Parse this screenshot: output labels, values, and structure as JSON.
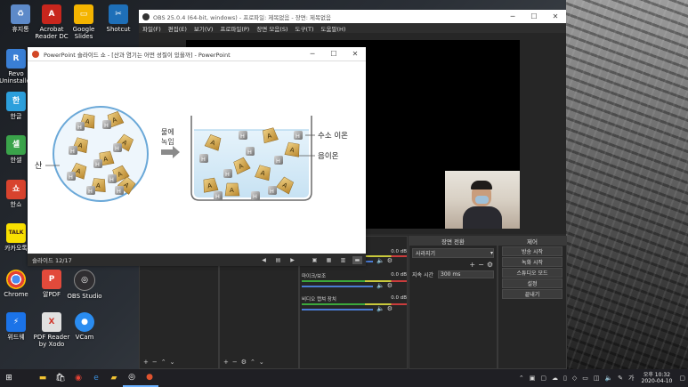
{
  "desktop": {
    "icons": [
      {
        "label": "휴지통",
        "icon": "recycle-bin-icon",
        "color": "#5d8ac9",
        "glyph": "♻"
      },
      {
        "label": "Acrobat Reader DC",
        "icon": "acrobat-icon",
        "color": "#c8261d",
        "glyph": "A"
      },
      {
        "label": "Google Slides",
        "icon": "google-slides-icon",
        "color": "#f4b400",
        "glyph": "▭"
      },
      {
        "label": "Shotcut",
        "icon": "shotcut-icon",
        "color": "#1e6fb8",
        "glyph": "✂"
      },
      {
        "label": "Revo Uninstaller",
        "icon": "revo-icon",
        "color": "#3a7fd5",
        "glyph": "R"
      },
      {
        "label": "한글",
        "icon": "hangul-icon",
        "color": "#2c9fdc",
        "glyph": "한"
      },
      {
        "label": "한셀",
        "icon": "hancell-icon",
        "color": "#3aa34a",
        "glyph": "셀"
      },
      {
        "label": "한쇼",
        "icon": "hanshow-icon",
        "color": "#d8432e",
        "glyph": "쇼"
      },
      {
        "label": "카카오톡",
        "icon": "kakaotalk-icon",
        "color": "#f9e000",
        "glyph": "TALK"
      },
      {
        "label": "Chrome",
        "icon": "chrome-icon",
        "color": "#3a8fdc",
        "glyph": "◉"
      },
      {
        "label": "알PDF",
        "icon": "alpdf-icon",
        "color": "#e24a3b",
        "glyph": "P"
      },
      {
        "label": "OBS Studio",
        "icon": "obs-icon",
        "color": "#302e31",
        "glyph": "◎"
      },
      {
        "label": "위드웨",
        "icon": "widwe-icon",
        "color": "#1b73e8",
        "glyph": "⚡"
      },
      {
        "label": "PDF Reader by Xodo",
        "icon": "xodo-icon",
        "color": "#e0e0e0",
        "glyph": "X"
      },
      {
        "label": "VCam",
        "icon": "vcam-icon",
        "color": "#2a8cf0",
        "glyph": "●"
      }
    ]
  },
  "obs": {
    "title": "OBS 25.0.4 (64-bit, windows) - 프로파일: 제목없음 - 장면: 제목없음",
    "menu": [
      "파일(F)",
      "편집(E)",
      "보기(V)",
      "프로파일(P)",
      "장면 모음(S)",
      "도구(T)",
      "도움말(H)"
    ],
    "transitions": {
      "header": "장면 전환",
      "type": "사라지기",
      "duration_label": "지속 시간",
      "duration_value": "300 ms"
    },
    "controls": {
      "header": "제어",
      "buttons": [
        "방송 시작",
        "녹화 시작",
        "스튜디오 모드",
        "설정",
        "끝내기"
      ]
    },
    "mixer": [
      {
        "name": "",
        "db": "0.0 dB"
      },
      {
        "name": "마이크/보조",
        "db": "0.0 dB"
      },
      {
        "name": "비디오 캡쳐 장치",
        "db": "0.0 dB"
      }
    ]
  },
  "ppt": {
    "title": "PowerPoint 슬라이드 쇼 - [산과 염기는 어떤 성질이 있을까] - PowerPoint",
    "slide_status": "슬라이드 12/17",
    "slide": {
      "label_acid": "산",
      "arrow_label": "물에\n녹임",
      "label_hydrogen": "수소 이온",
      "label_anion": "음이온",
      "h_glyph": "H",
      "a_glyph": "A",
      "accent_ion": "#c8a24a",
      "accent_h": "#7c7c7c"
    }
  },
  "taskbar": {
    "time": "오후 10:32",
    "date": "2020-04-10"
  }
}
